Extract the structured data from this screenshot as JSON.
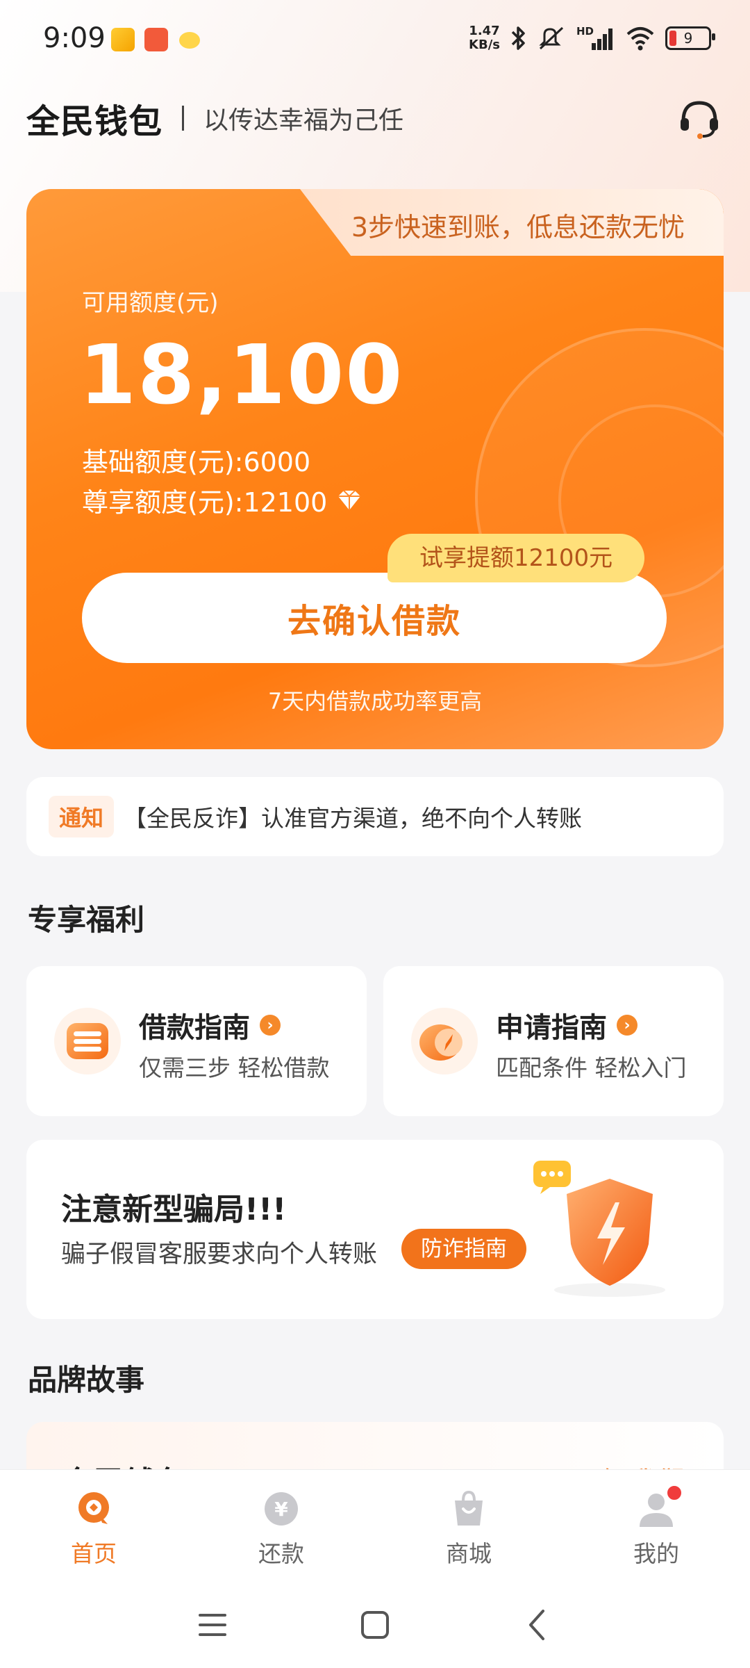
{
  "status_bar": {
    "time": "9:09",
    "speed_value": "1.47",
    "speed_unit": "KB/s",
    "network": "HD",
    "battery": "9"
  },
  "header": {
    "logo": "全民钱包",
    "slogan": "以传达幸福为己任",
    "service_icon": "headset-icon"
  },
  "credit_card": {
    "tab_text": "3步快速到账，低息还款无忧",
    "available_label": "可用额度(元)",
    "available_amount": "18,100",
    "base_line": "基础额度(元):6000",
    "vip_line": "尊享额度(元):12100",
    "trial_tag": "试享提额12100元",
    "confirm_button": "去确认借款",
    "hint": "7天内借款成功率更高"
  },
  "notice": {
    "tag": "通知",
    "text": "【全民反诈】认准官方渠道，绝不向个人转账"
  },
  "benefits": {
    "title": "专享福利",
    "items": [
      {
        "title": "借款指南",
        "subtitle": "仅需三步 轻松借款",
        "icon": "loan-guide-icon"
      },
      {
        "title": "申请指南",
        "subtitle": "匹配条件 轻松入门",
        "icon": "apply-guide-icon"
      }
    ]
  },
  "fraud": {
    "title": "注意新型骗局!!!",
    "desc": "骗子假冒客服要求向个人转账",
    "button": "防诈指南"
  },
  "brand": {
    "title": "品牌故事",
    "name": "全民钱包",
    "link": "了解我们"
  },
  "bottom_nav": [
    {
      "label": "首页",
      "active": true
    },
    {
      "label": "还款",
      "active": false
    },
    {
      "label": "商城",
      "active": false
    },
    {
      "label": "我的",
      "active": false,
      "badge": true
    }
  ],
  "colors": {
    "accent": "#f07a26",
    "card_orange": "#ff8418",
    "trial_yellow": "#ffe07a"
  }
}
